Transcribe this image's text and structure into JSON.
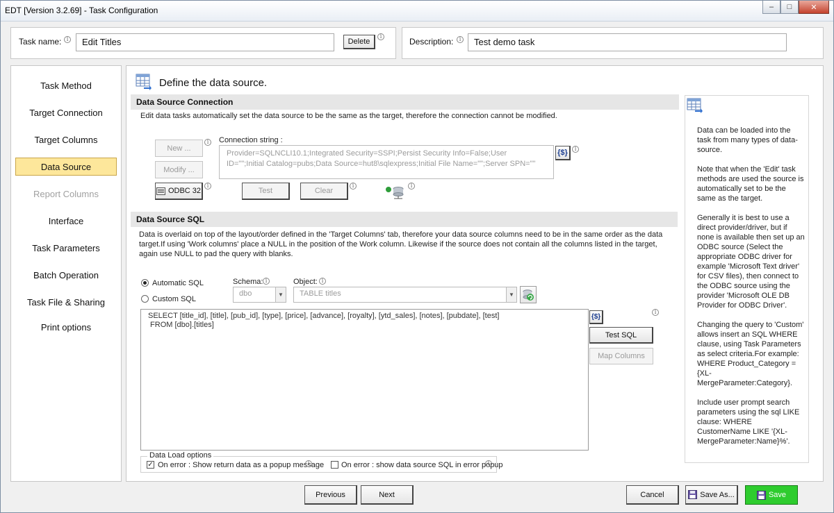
{
  "window": {
    "title": "EDT [Version 3.2.69] - Task Configuration"
  },
  "header": {
    "task_name_label": "Task name:",
    "task_name_value": "Edit Titles",
    "delete_label": "Delete",
    "description_label": "Description:",
    "description_value": "Test demo task"
  },
  "sidebar": {
    "items": [
      {
        "label": "Task Method"
      },
      {
        "label": "Target Connection"
      },
      {
        "label": "Target Columns"
      },
      {
        "label": "Data Source"
      },
      {
        "label": "Report Columns"
      },
      {
        "label": "Interface"
      },
      {
        "label": "Task Parameters"
      },
      {
        "label": "Batch Operation"
      },
      {
        "label": "Task File & Sharing"
      },
      {
        "label": "Print options"
      }
    ]
  },
  "main": {
    "title": "Define the data source.",
    "connection": {
      "header": "Data Source Connection",
      "note": "Edit data tasks automatically set the data source to be the same as the target, therefore the connection cannot be modified.",
      "new_label": "New ...",
      "modify_label": "Modify ...",
      "odbc_label": "ODBC 32",
      "conn_string_label": "Connection string :",
      "conn_string_value": "Provider=SQLNCLI10.1;Integrated Security=SSPI;Persist Security Info=False;User ID=\"\";Initial Catalog=pubs;Data Source=hut8\\sqlexpress;Initial File Name=\"\";Server SPN=\"\"",
      "test_label": "Test",
      "clear_label": "Clear",
      "param_button_label": "{$}"
    },
    "sql": {
      "header": "Data Source SQL",
      "note": "Data is overlaid on top of the layout/order defined in the 'Target Columns' tab,  therefore your data source columns need to be in the same order as the data target.If using 'Work columns' place a NULL in the position of the Work column.  Likewise if the source does not contain all the columns listed in the target,  again use NULL to pad the query with blanks.",
      "automatic_label": "Automatic SQL",
      "custom_label": "Custom SQL",
      "schema_label": "Schema:",
      "schema_value": "dbo",
      "object_label": "Object:",
      "object_value": "TABLE titles",
      "query": "SELECT [title_id], [title], [pub_id], [type], [price], [advance], [royalty], [ytd_sales], [notes], [pubdate], [test]\n FROM [dbo].[titles]",
      "param_button_label": "{$}",
      "test_sql_label": "Test SQL",
      "map_columns_label": "Map Columns"
    },
    "load_options": {
      "legend": "Data Load options",
      "option1_label": "On error : Show return data as a popup message",
      "option1_checked": true,
      "option2_label": "On error : show data source SQL in error popup",
      "option2_checked": false
    }
  },
  "help_panel": {
    "paragraphs": [
      "Data can be loaded into the task from many types of data-source.",
      "Note that when the 'Edit' task methods are used the source is automatically set to be the same as the target.",
      "Generally it is best to use a direct provider/driver, but if none is available then set up an ODBC source (Select the appropriate ODBC driver for example 'Microsoft Text driver' for CSV files), then connect to the ODBC source using the provider 'Microsoft OLE DB Provider for ODBC Driver'.",
      "Changing the query to 'Custom' allows insert an SQL WHERE clause, using Task Parameters as select criteria.For example: WHERE Product_Category = {XL-MergeParameter:Category}.",
      "Include user prompt search parameters using the sql LIKE clause: WHERE CustomerName LIKE '{XL-MergeParameter:Name}%'."
    ]
  },
  "footer": {
    "previous_label": "Previous",
    "next_label": "Next",
    "cancel_label": "Cancel",
    "save_as_label": "Save As...",
    "save_label": "Save"
  },
  "colors": {
    "active_nav": "#fde79b",
    "save_button": "#2ecc2e"
  }
}
